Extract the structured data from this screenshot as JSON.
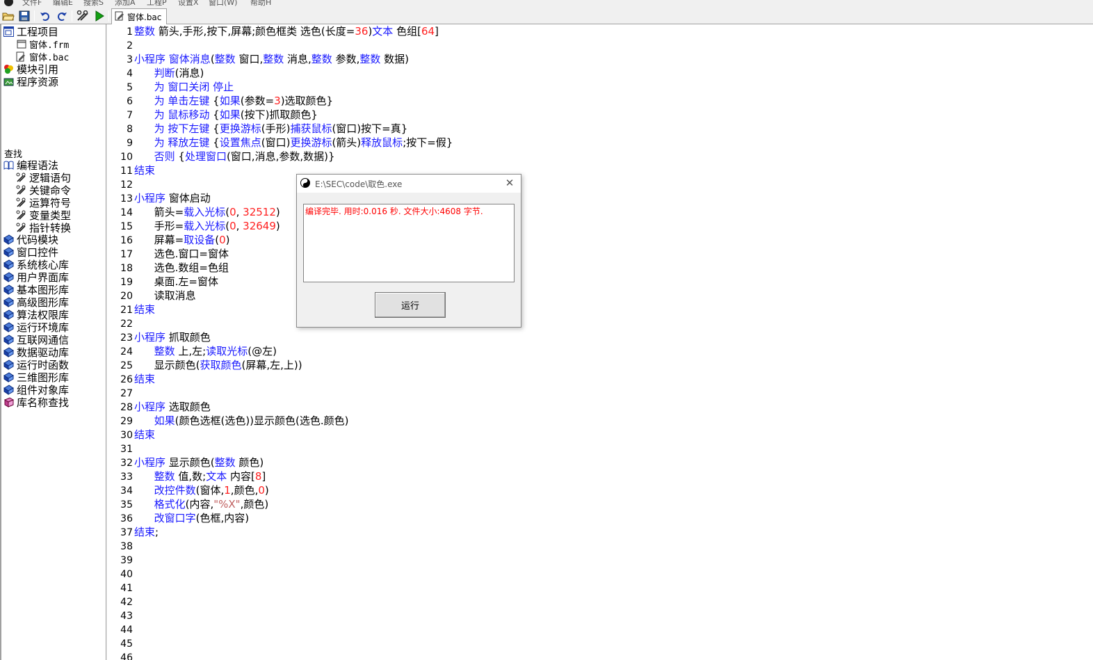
{
  "menu": {
    "items": [
      "文件F",
      "编辑E",
      "搜索S",
      "添加A",
      "工程P",
      "设置X",
      "窗口(W)",
      "帮助H"
    ]
  },
  "toolbar": {
    "buttons": [
      "open-folder-icon",
      "save-icon",
      "undo-icon",
      "redo-icon",
      "build-tools-icon",
      "run-play-icon"
    ]
  },
  "tab": {
    "label": "窗体.bac"
  },
  "project_tree": {
    "root": "工程项目",
    "files": [
      "窗体.frm",
      "窗体.bac"
    ],
    "module_ref": "模块引用",
    "resources": "程序资源"
  },
  "find": {
    "label": "查找",
    "grammar": "编程语法",
    "grammar_items": [
      "逻辑语句",
      "关键命令",
      "运算符号",
      "变量类型",
      "指针转换"
    ],
    "libraries": [
      "代码模块",
      "窗口控件",
      "系统核心库",
      "用户界面库",
      "基本图形库",
      "高级图形库",
      "算法权限库",
      "运行环境库",
      "互联网通信",
      "数据驱动库",
      "运行时函数",
      "三维图形库",
      "组件对象库"
    ],
    "search_lib": "库名称查找"
  },
  "code": {
    "lines": [
      [
        [
          "k",
          "整数"
        ],
        [
          "t",
          " 箭头,手形,按下,屏幕;颜色框类 选色(长度="
        ],
        [
          "n",
          "36"
        ],
        [
          "t",
          ")"
        ],
        [
          "k",
          "文本"
        ],
        [
          "t",
          " 色组["
        ],
        [
          "n",
          "64"
        ],
        [
          "t",
          "]"
        ]
      ],
      [],
      [
        [
          "k",
          "小程序"
        ],
        [
          "t",
          " "
        ],
        [
          "k",
          "窗体消息"
        ],
        [
          "t",
          "("
        ],
        [
          "k",
          "整数"
        ],
        [
          "t",
          " 窗口,"
        ],
        [
          "k",
          "整数"
        ],
        [
          "t",
          " 消息,"
        ],
        [
          "k",
          "整数"
        ],
        [
          "t",
          " 参数,"
        ],
        [
          "k",
          "整数"
        ],
        [
          "t",
          " 数据)"
        ]
      ],
      [
        [
          "t",
          "      "
        ],
        [
          "k",
          "判断"
        ],
        [
          "t",
          "(消息)"
        ]
      ],
      [
        [
          "t",
          "      "
        ],
        [
          "k",
          "为 窗口关闭 停止"
        ]
      ],
      [
        [
          "t",
          "      "
        ],
        [
          "k",
          "为 单击左键"
        ],
        [
          "t",
          " {"
        ],
        [
          "k",
          "如果"
        ],
        [
          "t",
          "(参数="
        ],
        [
          "n",
          "3"
        ],
        [
          "t",
          ")选取颜色}"
        ]
      ],
      [
        [
          "t",
          "      "
        ],
        [
          "k",
          "为 鼠标移动"
        ],
        [
          "t",
          " {"
        ],
        [
          "k",
          "如果"
        ],
        [
          "t",
          "(按下)抓取颜色}"
        ]
      ],
      [
        [
          "t",
          "      "
        ],
        [
          "k",
          "为 按下左键"
        ],
        [
          "t",
          " {"
        ],
        [
          "k",
          "更换游标"
        ],
        [
          "t",
          "(手形)"
        ],
        [
          "k",
          "捕获鼠标"
        ],
        [
          "t",
          "(窗口)按下=真}"
        ]
      ],
      [
        [
          "t",
          "      "
        ],
        [
          "k",
          "为 释放左键"
        ],
        [
          "t",
          " {"
        ],
        [
          "k",
          "设置焦点"
        ],
        [
          "t",
          "(窗口)"
        ],
        [
          "k",
          "更换游标"
        ],
        [
          "t",
          "(箭头)"
        ],
        [
          "k",
          "释放鼠标"
        ],
        [
          "t",
          ";按下=假}"
        ]
      ],
      [
        [
          "t",
          "      "
        ],
        [
          "k",
          "否则"
        ],
        [
          "t",
          " {"
        ],
        [
          "k",
          "处理窗口"
        ],
        [
          "t",
          "(窗口,消息,参数,数据)}"
        ]
      ],
      [
        [
          "k",
          "结束"
        ]
      ],
      [],
      [
        [
          "k",
          "小程序"
        ],
        [
          "t",
          " 窗体启动"
        ]
      ],
      [
        [
          "t",
          "      箭头="
        ],
        [
          "k",
          "载入光标"
        ],
        [
          "t",
          "("
        ],
        [
          "n",
          "0"
        ],
        [
          "t",
          ", "
        ],
        [
          "n",
          "32512"
        ],
        [
          "t",
          ")"
        ]
      ],
      [
        [
          "t",
          "      手形="
        ],
        [
          "k",
          "载入光标"
        ],
        [
          "t",
          "("
        ],
        [
          "n",
          "0"
        ],
        [
          "t",
          ", "
        ],
        [
          "n",
          "32649"
        ],
        [
          "t",
          ")"
        ]
      ],
      [
        [
          "t",
          "      屏幕="
        ],
        [
          "k",
          "取设备"
        ],
        [
          "t",
          "("
        ],
        [
          "n",
          "0"
        ],
        [
          "t",
          ")"
        ]
      ],
      [
        [
          "t",
          "      选色.窗口=窗体"
        ]
      ],
      [
        [
          "t",
          "      选色.数组=色组"
        ]
      ],
      [
        [
          "t",
          "      桌面.左=窗体"
        ]
      ],
      [
        [
          "t",
          "      读取消息"
        ]
      ],
      [
        [
          "k",
          "结束"
        ]
      ],
      [],
      [
        [
          "k",
          "小程序"
        ],
        [
          "t",
          " 抓取颜色"
        ]
      ],
      [
        [
          "t",
          "      "
        ],
        [
          "k",
          "整数"
        ],
        [
          "t",
          " 上,左;"
        ],
        [
          "k",
          "读取光标"
        ],
        [
          "t",
          "(@左)"
        ]
      ],
      [
        [
          "t",
          "      显示颜色("
        ],
        [
          "k",
          "获取颜色"
        ],
        [
          "t",
          "(屏幕,左,上))"
        ]
      ],
      [
        [
          "k",
          "结束"
        ]
      ],
      [],
      [
        [
          "k",
          "小程序"
        ],
        [
          "t",
          " 选取颜色"
        ]
      ],
      [
        [
          "t",
          "      "
        ],
        [
          "k",
          "如果"
        ],
        [
          "t",
          "(颜色选框(选色))显示颜色(选色.颜色)"
        ]
      ],
      [
        [
          "k",
          "结束"
        ]
      ],
      [],
      [
        [
          "k",
          "小程序"
        ],
        [
          "t",
          " 显示颜色("
        ],
        [
          "k",
          "整数"
        ],
        [
          "t",
          " 颜色)"
        ]
      ],
      [
        [
          "t",
          "      "
        ],
        [
          "k",
          "整数"
        ],
        [
          "t",
          " 值,数;"
        ],
        [
          "k",
          "文本"
        ],
        [
          "t",
          " 内容["
        ],
        [
          "n",
          "8"
        ],
        [
          "t",
          "]"
        ]
      ],
      [
        [
          "t",
          "      "
        ],
        [
          "k",
          "改控件数"
        ],
        [
          "t",
          "(窗体,"
        ],
        [
          "n",
          "1"
        ],
        [
          "t",
          ",颜色,"
        ],
        [
          "n",
          "0"
        ],
        [
          "t",
          ")"
        ]
      ],
      [
        [
          "t",
          "      "
        ],
        [
          "k",
          "格式化"
        ],
        [
          "t",
          "(内容,"
        ],
        [
          "s",
          "\"%X\""
        ],
        [
          "t",
          ",颜色)"
        ]
      ],
      [
        [
          "t",
          "      "
        ],
        [
          "k",
          "改窗口字"
        ],
        [
          "t",
          "(色框,内容)"
        ]
      ],
      [
        [
          "k",
          "结束"
        ],
        [
          "t",
          ";"
        ]
      ],
      [],
      [],
      [],
      [],
      [],
      [],
      [],
      [],
      []
    ]
  },
  "dialog": {
    "title": "E:\\SEC\\code\\取色.exe",
    "output": "编译完毕. 用时:0.016 秒. 文件大小:4608 字节.",
    "run_label": "运行"
  }
}
